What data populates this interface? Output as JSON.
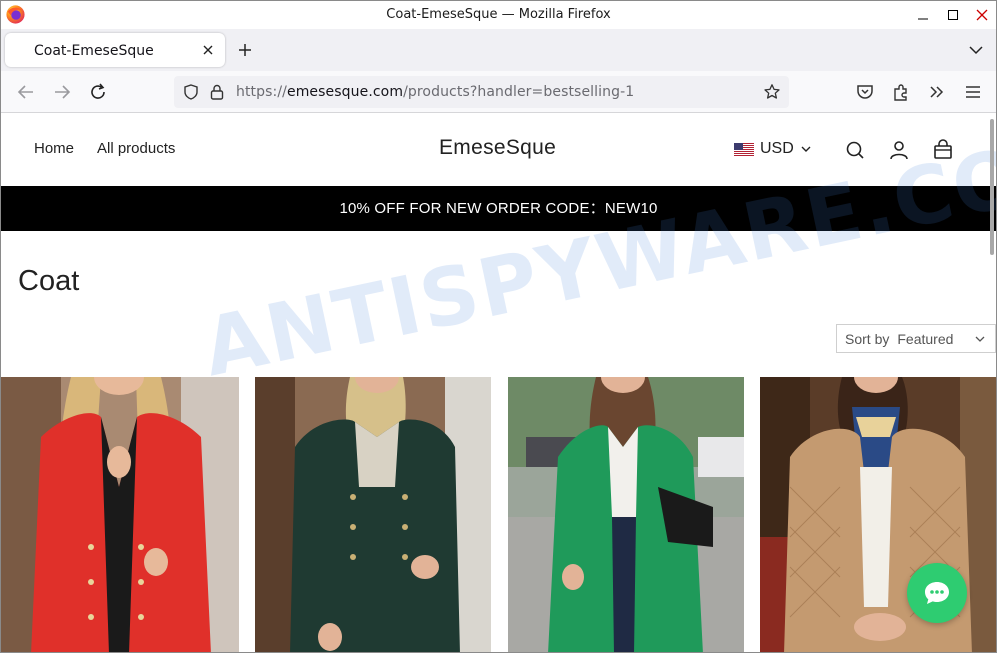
{
  "window": {
    "title": "Coat-EmeseSque — Mozilla Firefox"
  },
  "tab": {
    "label": "Coat-EmeseSque"
  },
  "urlbar": {
    "scheme": "https://",
    "host": "emesesque.com",
    "path": "/products?handler=bestselling-1"
  },
  "site": {
    "nav": [
      {
        "label": "Home"
      },
      {
        "label": "All products"
      }
    ],
    "brand": "EmeseSque",
    "currency": "USD",
    "promo": "10% OFF FOR NEW ORDER CODE：NEW10",
    "collection_title": "Coat",
    "sort": {
      "label": "Sort by",
      "value": "Featured"
    }
  },
  "products": [
    {
      "coat_color": "#e0302a",
      "bg": "#b08a6a"
    },
    {
      "coat_color": "#1f3a32",
      "bg": "#8a6a50"
    },
    {
      "coat_color": "#1f9a5a",
      "bg": "#8a9a88"
    },
    {
      "coat_color": "#c49a70",
      "bg": "#6a4a34"
    }
  ],
  "watermark": "ANTISPYWARE.COM",
  "colors": {
    "promo_bg": "#000000",
    "chat": "#2ecc71"
  }
}
